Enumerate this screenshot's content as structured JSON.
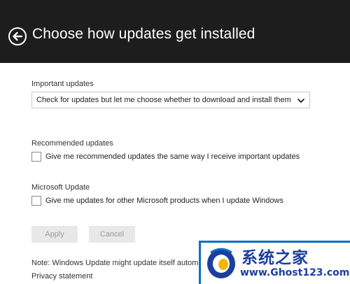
{
  "header": {
    "title": "Choose how updates get installed",
    "back_icon": "back-arrow-circle-icon"
  },
  "important_updates": {
    "label": "Important updates",
    "selected_option": "Check for updates but let me choose whether to download and install them"
  },
  "recommended_updates": {
    "label": "Recommended updates",
    "checkbox_label": "Give me recommended updates the same way I receive important updates",
    "checked": false
  },
  "microsoft_update": {
    "label": "Microsoft Update",
    "checkbox_label": "Give me updates for other Microsoft products when I update Windows",
    "checked": false
  },
  "buttons": {
    "apply": "Apply",
    "cancel": "Cancel"
  },
  "footer": {
    "note": "Note: Windows Update might update itself automatically first when checking for other updates.",
    "privacy": "Privacy statement"
  },
  "watermark": {
    "title": "系统之家",
    "url": "www.Ghost123.com"
  },
  "colors": {
    "header_bg": "#1d1d1d",
    "watermark_blue": "#1b3f9e"
  }
}
